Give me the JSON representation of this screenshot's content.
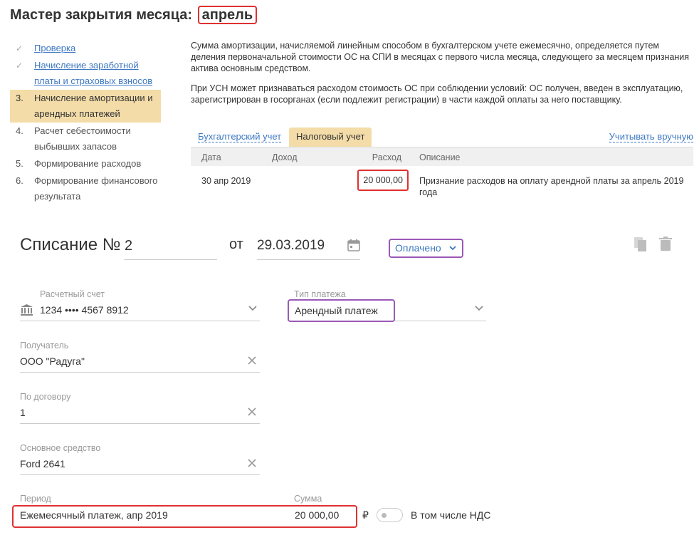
{
  "wizard": {
    "title": "Мастер закрытия месяца:",
    "month": "апрель",
    "steps": [
      {
        "num": "✓",
        "line1": "Проверка",
        "line2": ""
      },
      {
        "num": "✓",
        "line1": "Начисление заработной",
        "line2": "платы и страховых взносов"
      },
      {
        "num": "3.",
        "line1": "Начисление амортизации и",
        "line2": "арендных платежей"
      },
      {
        "num": "4.",
        "line1": "Расчет себестоимости",
        "line2": "выбывших запасов"
      },
      {
        "num": "5.",
        "line1": "Формирование расходов",
        "line2": ""
      },
      {
        "num": "6.",
        "line1": "Формирование финансового",
        "line2": "результата"
      }
    ],
    "info_p1": "Сумма амортизации, начисляемой линейным способом в бухгалтерском учете ежемесячно, определяется путем деления первоначальной стоимости ОС на СПИ в месяцах с первого числа месяца, следующего за месяцем признания актива основным средством.",
    "info_p2": "При УСН может признаваться расходом стоимость ОС при соблюдении условий: ОС получен, введен в эксплуатацию, зарегистрирован в госорганах (если подлежит регистрации) в части каждой оплаты за него поставщику.",
    "tabs": {
      "accounting": "Бухгалтерский учет",
      "tax": "Налоговый учет",
      "manual": "Учитывать вручную"
    },
    "table": {
      "headers": {
        "date": "Дата",
        "income": "Доход",
        "expense": "Расход",
        "description": "Описание"
      },
      "rows": [
        {
          "date": "30 апр 2019",
          "income": "",
          "expense": "20 000,00",
          "description": "Признание расходов на оплату арендной платы за апрель 2019 года"
        }
      ]
    }
  },
  "doc": {
    "title": "Списание №",
    "number": "2",
    "from_label": "от",
    "date": "29.03.2019",
    "status": "Оплачено"
  },
  "form": {
    "account": {
      "label": "Расчетный счет",
      "value": "1234 •••• 4567 8912"
    },
    "payment_type": {
      "label": "Тип платежа",
      "value": "Арендный платеж"
    },
    "recipient": {
      "label": "Получатель",
      "value": "ООО \"Радуга\""
    },
    "contract": {
      "label": "По договору",
      "value": "1"
    },
    "asset": {
      "label": "Основное средство",
      "value": "Ford 2641"
    },
    "period": {
      "label": "Период",
      "value": "Ежемесячный платеж, апр 2019"
    },
    "sum": {
      "label": "Сумма",
      "value": "20 000,00",
      "currency": "₽"
    },
    "vat": {
      "label": "В том числе НДС",
      "enabled": false
    }
  },
  "colors": {
    "link": "#3d78c2",
    "highlight": "#f3dca8",
    "red_box": "#e03030",
    "purple_box": "#9b59b6"
  },
  "icons": [
    "calendar-icon",
    "chevron-down-icon",
    "copy-icon",
    "trash-icon",
    "bank-icon",
    "close-icon",
    "check-icon"
  ]
}
